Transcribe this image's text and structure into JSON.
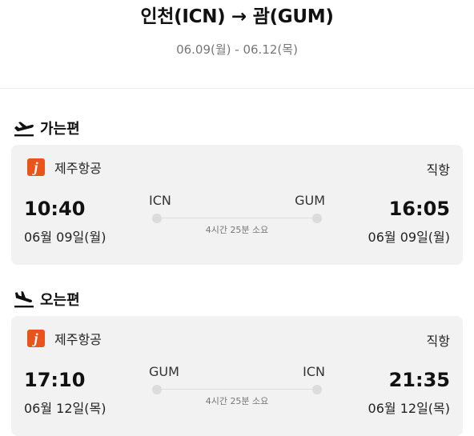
{
  "header": {
    "title": "인천(ICN) → 괌(GUM)",
    "dates": "06.09(월) - 06.12(목)"
  },
  "outbound": {
    "section_label": "가는편",
    "airline": "제주항공",
    "logo_letter": "j",
    "flight_type": "직항",
    "depart_time": "10:40",
    "depart_date": "06월 09일(월)",
    "depart_code": "ICN",
    "arrive_code": "GUM",
    "arrive_time": "16:05",
    "arrive_date": "06월 09일(월)",
    "duration": "4시간 25분 소요"
  },
  "inbound": {
    "section_label": "오는편",
    "airline": "제주항공",
    "logo_letter": "j",
    "flight_type": "직항",
    "depart_time": "17:10",
    "depart_date": "06월 12일(목)",
    "depart_code": "GUM",
    "arrive_code": "ICN",
    "arrive_time": "21:35",
    "arrive_date": "06월 12일(목)",
    "duration": "4시간 25분 소요"
  },
  "colors": {
    "brand_logo": "#e8541b",
    "card_bg": "#f2f2f2"
  },
  "icons": {
    "outbound": "plane-departure-icon",
    "inbound": "plane-arrival-icon"
  }
}
